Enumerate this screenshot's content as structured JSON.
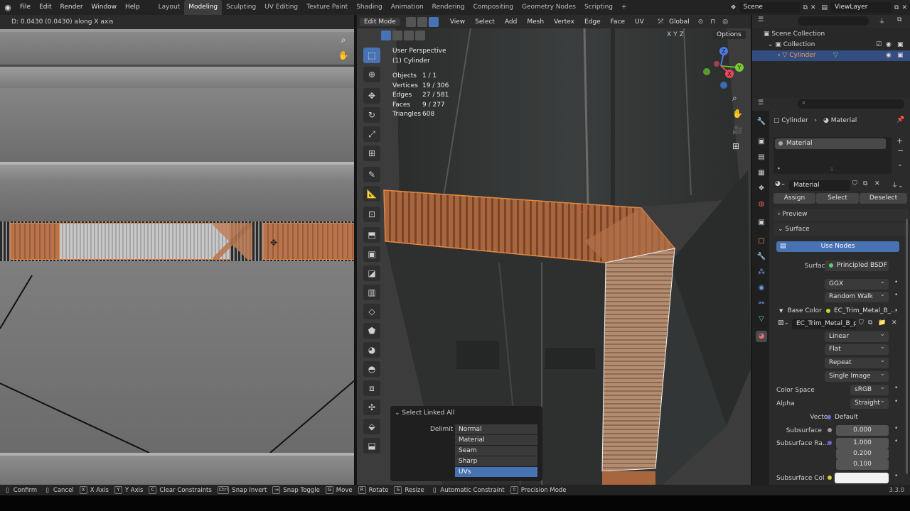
{
  "app": {
    "menus": [
      "File",
      "Edit",
      "Render",
      "Window",
      "Help"
    ],
    "workspaces": [
      "Layout",
      "Modeling",
      "Sculpting",
      "UV Editing",
      "Texture Paint",
      "Shading",
      "Animation",
      "Rendering",
      "Compositing",
      "Geometry Nodes",
      "Scripting"
    ],
    "active_workspace": "Modeling",
    "add_tab_label": "+",
    "scene": "Scene",
    "view_layer": "ViewLayer"
  },
  "uv_editor": {
    "header_text": "D: 0.0430 (0.0430) along X axis"
  },
  "viewport": {
    "mode": "Edit Mode",
    "menus": [
      "View",
      "Select",
      "Add",
      "Mesh",
      "Vertex",
      "Edge",
      "Face",
      "UV"
    ],
    "orientation": "Global",
    "options_label": "Options",
    "axes": [
      "X",
      "Y",
      "Z"
    ],
    "perspective": "User Perspective",
    "object": "(1) Cylinder",
    "stats": [
      {
        "label": "Objects",
        "value": "1 / 1"
      },
      {
        "label": "Vertices",
        "value": "19 / 306"
      },
      {
        "label": "Edges",
        "value": "27 / 581"
      },
      {
        "label": "Faces",
        "value": "9 / 277"
      },
      {
        "label": "Triangles",
        "value": "608"
      }
    ],
    "gizmo": {
      "x": "X",
      "y": "Y",
      "z": "Z"
    }
  },
  "operator_panel": {
    "title": "Select Linked All",
    "delimit_label": "Delimit",
    "options": [
      "Normal",
      "Material",
      "Seam",
      "Sharp",
      "UVs"
    ],
    "active_option": "UVs"
  },
  "outliner": {
    "scene_collection": "Scene Collection",
    "collection": "Collection",
    "object": "Cylinder"
  },
  "properties": {
    "breadcrumb_object": "Cylinder",
    "breadcrumb_material": "Material",
    "slot": "Material",
    "material_name": "Material",
    "assign": "Assign",
    "select": "Select",
    "deselect": "Deselect",
    "preview": "Preview",
    "surface_section": "Surface",
    "use_nodes": "Use Nodes",
    "surface_label": "Surface",
    "surface_value": "Principled BSDF",
    "distribution": "GGX",
    "subsurface_method": "Random Walk",
    "base_color_label": "Base Color",
    "base_color_value": "EC_Trim_Metal_B_...",
    "image_name": "EC_Trim_Metal_B_p...",
    "interpolation": "Linear",
    "projection": "Flat",
    "extension": "Repeat",
    "source": "Single Image",
    "color_space_label": "Color Space",
    "color_space": "sRGB",
    "alpha_label": "Alpha",
    "alpha": "Straight",
    "vector_label": "Vector",
    "vector": "Default",
    "subsurface_label": "Subsurface",
    "subsurface": "0.000",
    "subsurface_radius_label": "Subsurface Ra...",
    "subsurface_radius": [
      "1.000",
      "0.200",
      "0.100"
    ],
    "subsurface_color_label": "Subsurface Col"
  },
  "statusbar": {
    "items": [
      {
        "key": "",
        "label": "Confirm"
      },
      {
        "key": "",
        "label": "Cancel"
      },
      {
        "key": "X",
        "label": "X Axis"
      },
      {
        "key": "Y",
        "label": "Y Axis"
      },
      {
        "key": "C",
        "label": "Clear Constraints"
      },
      {
        "key": "Ctrl",
        "label": "Snap Invert"
      },
      {
        "key": "",
        "label": "Snap Toggle"
      },
      {
        "key": "G",
        "label": "Move"
      },
      {
        "key": "R",
        "label": "Rotate"
      },
      {
        "key": "S",
        "label": "Resize"
      },
      {
        "key": "",
        "label": "Automatic Constraint"
      },
      {
        "key": "",
        "label": "Precision Mode"
      }
    ],
    "version": "3.3.0"
  },
  "colors": {
    "accent": "#4772b3",
    "selection_orange": "#c87a4a",
    "active_object": "#f0a050"
  }
}
